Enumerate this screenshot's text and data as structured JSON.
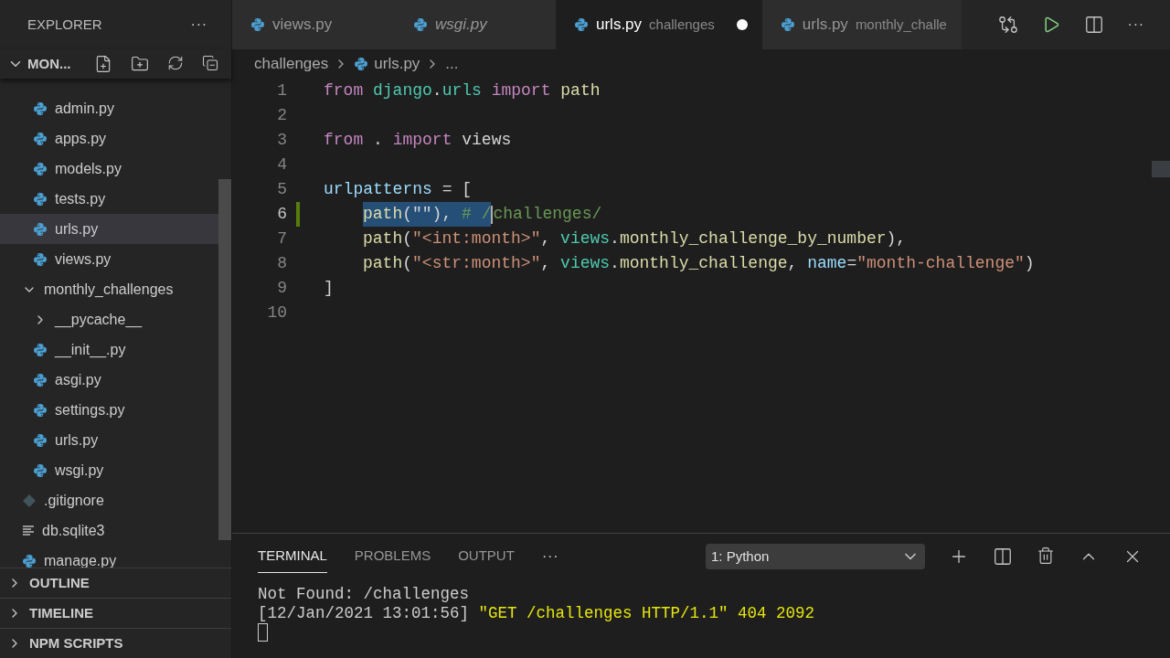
{
  "sidebar": {
    "title": "EXPLORER",
    "more": "···",
    "root": {
      "label": "MON...",
      "expanded": true
    },
    "tree": [
      {
        "children": [
          {
            "name": "admin.py",
            "kind": "python",
            "selected": false
          },
          {
            "name": "apps.py",
            "kind": "python",
            "selected": false
          },
          {
            "name": "models.py",
            "kind": "python",
            "selected": false
          },
          {
            "name": "tests.py",
            "kind": "python",
            "selected": false
          },
          {
            "name": "urls.py",
            "kind": "python",
            "selected": true
          },
          {
            "name": "views.py",
            "kind": "python",
            "selected": false
          }
        ]
      },
      {
        "name": "monthly_challenges",
        "kind": "folder",
        "expanded": true,
        "selected": false,
        "children": [
          {
            "name": "__pycache__",
            "kind": "folder",
            "expanded": false,
            "selected": false
          },
          {
            "name": "__init__.py",
            "kind": "python",
            "selected": false
          },
          {
            "name": "asgi.py",
            "kind": "python",
            "selected": false
          },
          {
            "name": "settings.py",
            "kind": "python",
            "selected": false
          },
          {
            "name": "urls.py",
            "kind": "python",
            "selected": false
          },
          {
            "name": "wsgi.py",
            "kind": "python",
            "selected": false
          }
        ]
      },
      {
        "name": ".gitignore",
        "kind": "git",
        "selected": false
      },
      {
        "name": "db.sqlite3",
        "kind": "text",
        "selected": false
      },
      {
        "name": "manage.py",
        "kind": "python",
        "selected": false
      }
    ],
    "sections": [
      {
        "label": "OUTLINE",
        "expanded": false
      },
      {
        "label": "TIMELINE",
        "expanded": false
      },
      {
        "label": "NPM SCRIPTS",
        "expanded": false
      }
    ]
  },
  "tabs": [
    {
      "label": "views.py",
      "selected": false,
      "preview": false,
      "dirty": false
    },
    {
      "label": "wsgi.py",
      "selected": false,
      "preview": true,
      "dirty": false
    },
    {
      "label": "urls.py",
      "description": "challenges",
      "selected": true,
      "preview": false,
      "dirty": true
    },
    {
      "label": "urls.py",
      "description": "monthly_challe",
      "selected": false,
      "preview": false,
      "dirty": false
    }
  ],
  "breadcrumbs": [
    "challenges",
    "urls.py",
    "..."
  ],
  "code": [
    {
      "number": "1",
      "tokens": [
        {
          "text": "from ",
          "kind": "keyword",
          "selected": false
        },
        {
          "text": "django",
          "kind": "module",
          "selected": false
        },
        {
          "text": ".",
          "kind": "plain",
          "selected": false
        },
        {
          "text": "urls ",
          "kind": "module",
          "selected": false
        },
        {
          "text": "import ",
          "kind": "keyword",
          "selected": false
        },
        {
          "text": "path",
          "kind": "func",
          "selected": false
        }
      ]
    },
    {
      "number": "2"
    },
    {
      "number": "3",
      "tokens": [
        {
          "text": "from ",
          "kind": "keyword",
          "selected": false
        },
        {
          "text": ". ",
          "kind": "plain",
          "selected": false
        },
        {
          "text": "import ",
          "kind": "keyword",
          "selected": false
        },
        {
          "text": "views",
          "kind": "plain",
          "selected": false
        }
      ]
    },
    {
      "number": "4"
    },
    {
      "number": "5",
      "tokens": [
        {
          "text": "urlpatterns",
          "kind": "variable",
          "selected": false
        },
        {
          "text": " = [",
          "kind": "plain",
          "selected": false
        }
      ]
    },
    {
      "number": "6",
      "indented": true,
      "modified": true,
      "current": true,
      "tokens": [
        {
          "text": "path",
          "kind": "func",
          "selected": true
        },
        {
          "text": "(\"\"), ",
          "kind": "plain",
          "selected": true
        },
        {
          "text": "# /",
          "kind": "comment",
          "selected": true
        },
        {
          "text": "challenges/",
          "kind": "comment",
          "selected": false
        }
      ]
    },
    {
      "number": "7",
      "indented": true,
      "tokens": [
        {
          "text": "path",
          "kind": "func",
          "selected": false
        },
        {
          "text": "(",
          "kind": "plain",
          "selected": false
        },
        {
          "text": "\"<int:month>\"",
          "kind": "string",
          "selected": false
        },
        {
          "text": ", ",
          "kind": "plain",
          "selected": false
        },
        {
          "text": "views",
          "kind": "module",
          "selected": false
        },
        {
          "text": ".",
          "kind": "plain",
          "selected": false
        },
        {
          "text": "monthly_challenge_by_number",
          "kind": "func",
          "selected": false
        },
        {
          "text": "),",
          "kind": "plain",
          "selected": false
        }
      ]
    },
    {
      "number": "8",
      "indented": true,
      "tokens": [
        {
          "text": "path",
          "kind": "func",
          "selected": false
        },
        {
          "text": "(",
          "kind": "plain",
          "selected": false
        },
        {
          "text": "\"<str:month>\"",
          "kind": "string",
          "selected": false
        },
        {
          "text": ", ",
          "kind": "plain",
          "selected": false
        },
        {
          "text": "views",
          "kind": "module",
          "selected": false
        },
        {
          "text": ".",
          "kind": "plain",
          "selected": false
        },
        {
          "text": "monthly_challenge",
          "kind": "func",
          "selected": false
        },
        {
          "text": ", ",
          "kind": "plain",
          "selected": false
        },
        {
          "text": "name",
          "kind": "variable",
          "selected": false
        },
        {
          "text": "=",
          "kind": "plain",
          "selected": false
        },
        {
          "text": "\"month-challenge\"",
          "kind": "string",
          "selected": false
        },
        {
          "text": ")",
          "kind": "plain",
          "selected": false
        }
      ]
    },
    {
      "number": "9",
      "tokens": [
        {
          "text": "]",
          "kind": "plain",
          "selected": false
        }
      ]
    },
    {
      "number": "10"
    }
  ],
  "panel": {
    "tabs": [
      {
        "label": "TERMINAL",
        "selected": true
      },
      {
        "label": "PROBLEMS",
        "selected": false
      },
      {
        "label": "OUTPUT",
        "selected": false
      }
    ],
    "more": "···",
    "terminal_select": "1: Python",
    "terminal": [
      [
        {
          "text": "Not Found: /challenges",
          "kind": "plain"
        }
      ],
      [
        {
          "text": "[12/Jan/2021 13:01:56] ",
          "kind": "plain"
        },
        {
          "text": "\"GET /challenges HTTP/1.1\" 404 2092",
          "kind": "highlight"
        }
      ]
    ]
  }
}
